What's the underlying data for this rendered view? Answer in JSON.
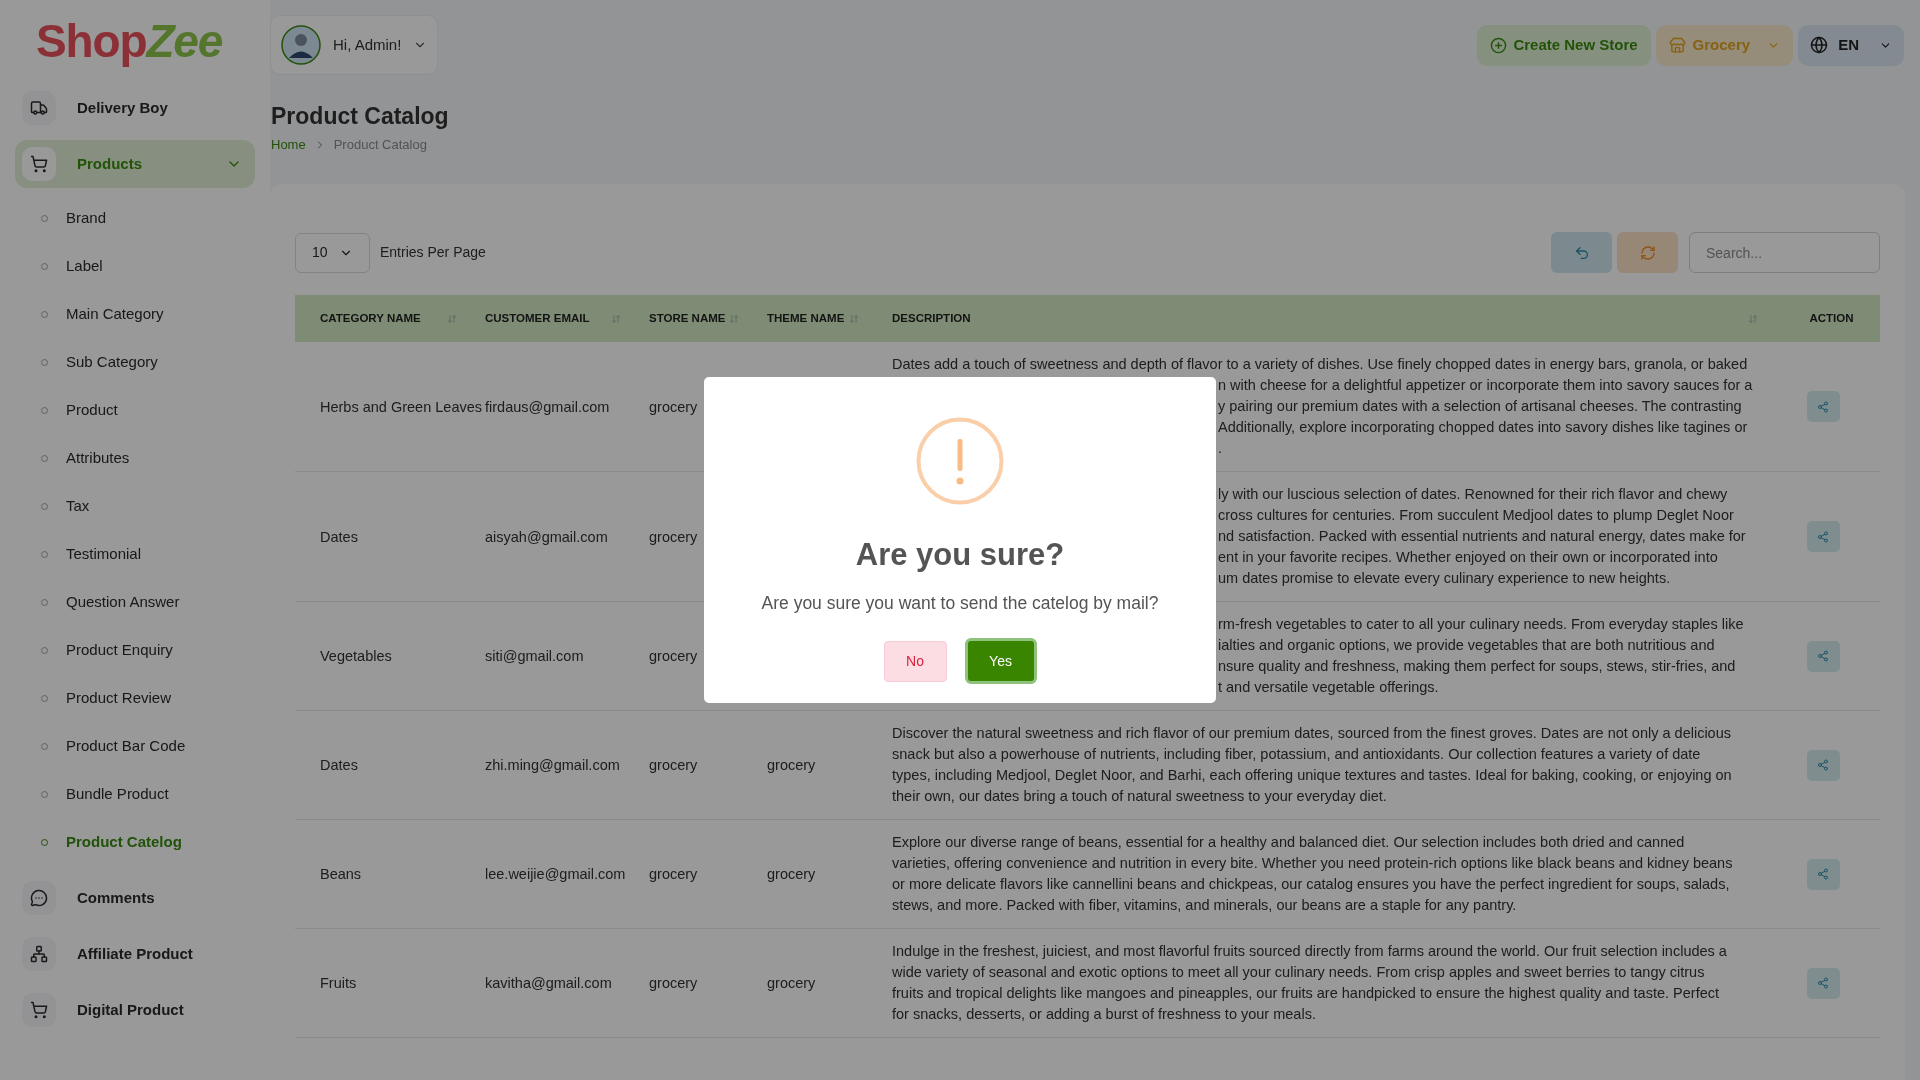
{
  "logo": {
    "part_1": "Shop",
    "part_2": "Zee"
  },
  "user_menu": {
    "greeting": "Hi, Admin!"
  },
  "header_actions": {
    "create_store": "Create New Store",
    "store_select": "Grocery",
    "language": "EN"
  },
  "sidebar": {
    "items": [
      {
        "label": "Delivery Boy",
        "kind": "truck",
        "selected": false
      },
      {
        "label": "Products",
        "kind": "cart",
        "selected": true,
        "children": [
          {
            "label": "Brand",
            "selected": false
          },
          {
            "label": "Label",
            "selected": false
          },
          {
            "label": "Main Category",
            "selected": false
          },
          {
            "label": "Sub Category",
            "selected": false
          },
          {
            "label": "Product",
            "selected": false
          },
          {
            "label": "Attributes",
            "selected": false
          },
          {
            "label": "Tax",
            "selected": false
          },
          {
            "label": "Testimonial",
            "selected": false
          },
          {
            "label": "Question Answer",
            "selected": false
          },
          {
            "label": "Product Enquiry",
            "selected": false
          },
          {
            "label": "Product Review",
            "selected": false
          },
          {
            "label": "Product Bar Code",
            "selected": false
          },
          {
            "label": "Bundle Product",
            "selected": false
          },
          {
            "label": "Product Catelog",
            "selected": true
          }
        ]
      },
      {
        "label": "Comments",
        "kind": "chat",
        "selected": false
      },
      {
        "label": "Affiliate Product",
        "kind": "network",
        "selected": false
      },
      {
        "label": "Digital Product",
        "kind": "cart_plus",
        "selected": false
      }
    ]
  },
  "page": {
    "title": "Product Catalog",
    "breadcrumb": [
      "Home",
      "Product Catalog"
    ]
  },
  "toolbar": {
    "entries_value": "10",
    "entries_label": "Entries Per Page",
    "search_placeholder": "Search..."
  },
  "table": {
    "columns": [
      {
        "label": "CATEGORY NAME",
        "sortable": true
      },
      {
        "label": "CUSTOMER EMAIL",
        "sortable": true
      },
      {
        "label": "STORE NAME",
        "sortable": true
      },
      {
        "label": "THEME NAME",
        "sortable": true
      },
      {
        "label": "DESCRIPTION",
        "sortable": true
      },
      {
        "label": "ACTION",
        "sortable": false
      }
    ],
    "rows": [
      {
        "category": "Herbs and Green Leaves",
        "email": "firdaus@gmail.com",
        "store": "grocery",
        "description_lines": [
          {
            "text": "Dates add a touch of sweetness and depth of flavor to a variety of dishes. Use finely chopped dates in energy bars, granola, or baked",
            "cut": false
          },
          {
            "text": "n with cheese for a delightful appetizer or incorporate them into savory sauces for a",
            "cut": true
          },
          {
            "text": "y pairing our premium dates with a selection of artisanal cheeses. The contrasting",
            "cut": true
          },
          {
            "text": "Additionally, explore incorporating chopped dates into savory dishes like tagines or",
            "cut": true
          },
          {
            "text": ".",
            "cut": true
          }
        ]
      },
      {
        "category": "Dates",
        "email": "aisyah@gmail.com",
        "store": "grocery",
        "description_lines": [
          {
            "text": "ly with our luscious selection of dates. Renowned for their rich flavor and chewy",
            "cut": true
          },
          {
            "text": "cross cultures for centuries. From succulent Medjool dates to plump Deglet Noor",
            "cut": true
          },
          {
            "text": "nd satisfaction. Packed with essential nutrients and natural energy, dates make for",
            "cut": true
          },
          {
            "text": "ent in your favorite recipes. Whether enjoyed on their own or incorporated into",
            "cut": true
          },
          {
            "text": "um dates promise to elevate every culinary experience to new heights.",
            "cut": true
          }
        ]
      },
      {
        "category": "Vegetables",
        "email": "siti@gmail.com",
        "store": "grocery",
        "description_lines": [
          {
            "text": "rm-fresh vegetables to cater to all your culinary needs. From everyday staples like",
            "cut": true
          },
          {
            "text": "ialties and organic options, we provide vegetables that are both nutritious and",
            "cut": true
          },
          {
            "text": "nsure quality and freshness, making them perfect for soups, stews, stir-fries, and",
            "cut": true
          },
          {
            "text": "t and versatile vegetable offerings.",
            "cut": true
          }
        ]
      },
      {
        "category": "Dates",
        "email": "zhi.ming@gmail.com",
        "store": "grocery",
        "theme": "grocery",
        "description": "Discover the natural sweetness and rich flavor of our premium dates, sourced from the finest groves. Dates are not only a delicious snack but also a powerhouse of nutrients, including fiber, potassium, and antioxidants. Our collection features a variety of date types, including Medjool, Deglet Noor, and Barhi, each offering unique textures and tastes. Ideal for baking, cooking, or enjoying on their own, our dates bring a touch of natural sweetness to your everyday diet."
      },
      {
        "category": "Beans",
        "email": "lee.weijie@gmail.com",
        "store": "grocery",
        "theme": "grocery",
        "description": "Explore our diverse range of beans, essential for a healthy and balanced diet. Our selection includes both dried and canned varieties, offering convenience and nutrition in every bite. Whether you need protein-rich options like black beans and kidney beans or more delicate flavors like cannellini beans and chickpeas, our catalog ensures you have the perfect ingredient for soups, salads, stews, and more. Packed with fiber, vitamins, and minerals, our beans are a staple for any pantry."
      },
      {
        "category": "Fruits",
        "email": "kavitha@gmail.com",
        "store": "grocery",
        "theme": "grocery",
        "description": "Indulge in the freshest, juiciest, and most flavorful fruits sourced directly from farms around the world. Our fruit selection includes a wide variety of seasonal and exotic options to meet all your culinary needs. From crisp apples and sweet berries to tangy citrus fruits and tropical delights like mangoes and pineapples, our fruits are handpicked to ensure the highest quality and taste. Perfect for snacks, desserts, or adding a burst of freshness to your meals."
      }
    ]
  },
  "dialog": {
    "title": "Are you sure?",
    "message": "Are you sure you want to send the catelog by mail?",
    "cancel": "No",
    "confirm": "Yes"
  }
}
